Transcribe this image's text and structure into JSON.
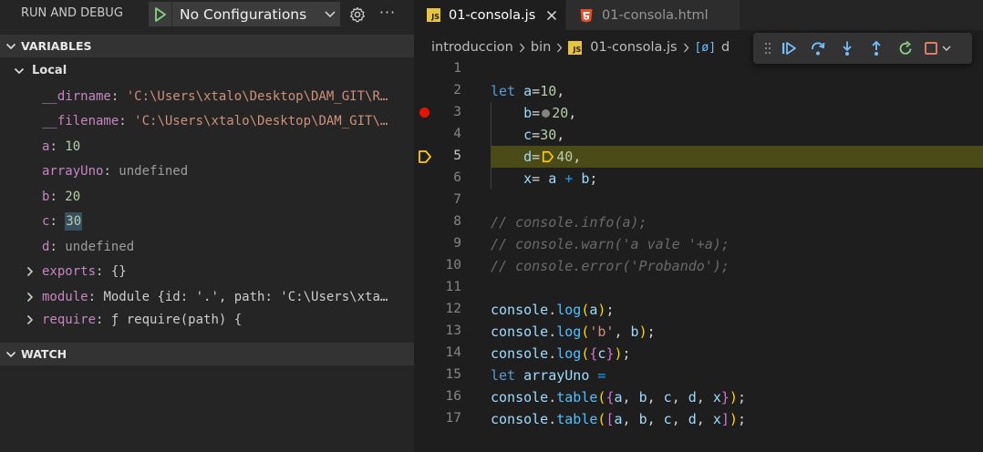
{
  "debug_panel": {
    "title": "RUN AND DEBUG",
    "configuration": "No Configurations",
    "sections": {
      "variables": "VARIABLES",
      "watch": "WATCH"
    },
    "scope": "Local",
    "variables": [
      {
        "name": "__dirname",
        "value": "'C:\\Users\\xtalo\\Desktop\\DAM_GIT\\R…",
        "kind": "string"
      },
      {
        "name": "__filename",
        "value": "'C:\\Users\\xtalo\\Desktop\\DAM_GIT\\…",
        "kind": "string"
      },
      {
        "name": "a",
        "value": "10",
        "kind": "number"
      },
      {
        "name": "arrayUno",
        "value": "undefined",
        "kind": "undefined"
      },
      {
        "name": "b",
        "value": "20",
        "kind": "number"
      },
      {
        "name": "c",
        "value": "30",
        "kind": "number"
      },
      {
        "name": "d",
        "value": "undefined",
        "kind": "undefined"
      },
      {
        "name": "exports",
        "value": "{}",
        "kind": "object"
      },
      {
        "name": "module",
        "value": "Module {id: '.', path: 'C:\\Users\\xta…",
        "kind": "object"
      },
      {
        "name": "require",
        "value": "ƒ require(path) {",
        "kind": "object"
      }
    ]
  },
  "tabs": [
    {
      "label": "01-consola.js",
      "type": "js",
      "active": true
    },
    {
      "label": "01-consola.html",
      "type": "html",
      "active": false
    }
  ],
  "breadcrumb": {
    "items": [
      "introduccion",
      "bin",
      "01-consola.js",
      "d"
    ],
    "symbol_glyph": "[ø]"
  },
  "code": {
    "line_numbers": [
      "1",
      "2",
      "3",
      "4",
      "5",
      "6",
      "7",
      "8",
      "9",
      "10",
      "11",
      "12",
      "13",
      "14",
      "15",
      "16",
      "17"
    ],
    "breakpoint_line": 3,
    "current_line": 5
  },
  "colors": {
    "current_line_bg": "#4b4b18",
    "breakpoint": "#e51400",
    "stack_arrow": "#ffcc00",
    "continue": "#75beff",
    "restart": "#89d185",
    "stop": "#f48771"
  }
}
